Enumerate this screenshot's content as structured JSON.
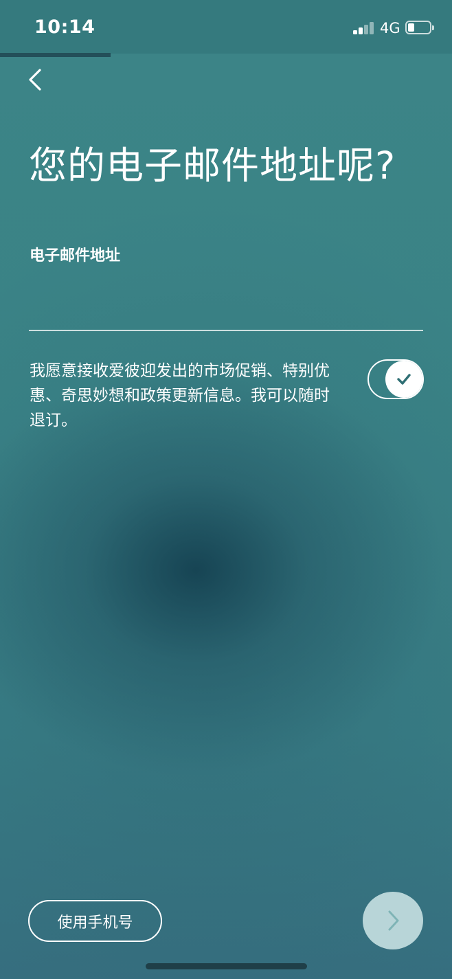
{
  "status_bar": {
    "time": "10:14",
    "network": "4G",
    "signal_bars_active": 2,
    "signal_bars_total": 4,
    "battery_level": 0.3,
    "icons": [
      "signal-icon",
      "battery-icon"
    ]
  },
  "progress": {
    "fraction": 0.245
  },
  "header": {
    "back_icon": "chevron-left-icon"
  },
  "main": {
    "title": "您的电子邮件地址呢?",
    "email_label": "电子邮件地址",
    "email_value": "",
    "email_placeholder": "",
    "consent_text": "我愿意接收爱彼迎发出的市场促销、特别优惠、奇思妙想和政策更新信息。我可以随时退订。",
    "consent_toggle": {
      "checked": true,
      "icon": "checkmark-icon"
    }
  },
  "footer": {
    "phone_button_label": "使用手机号",
    "next_icon": "chevron-right-icon"
  },
  "colors": {
    "background": "#3b8386",
    "status_bar": "#357a7e",
    "progress": "#234f59",
    "accent_check": "#2f6f74",
    "next_button": "#d6ebec"
  }
}
